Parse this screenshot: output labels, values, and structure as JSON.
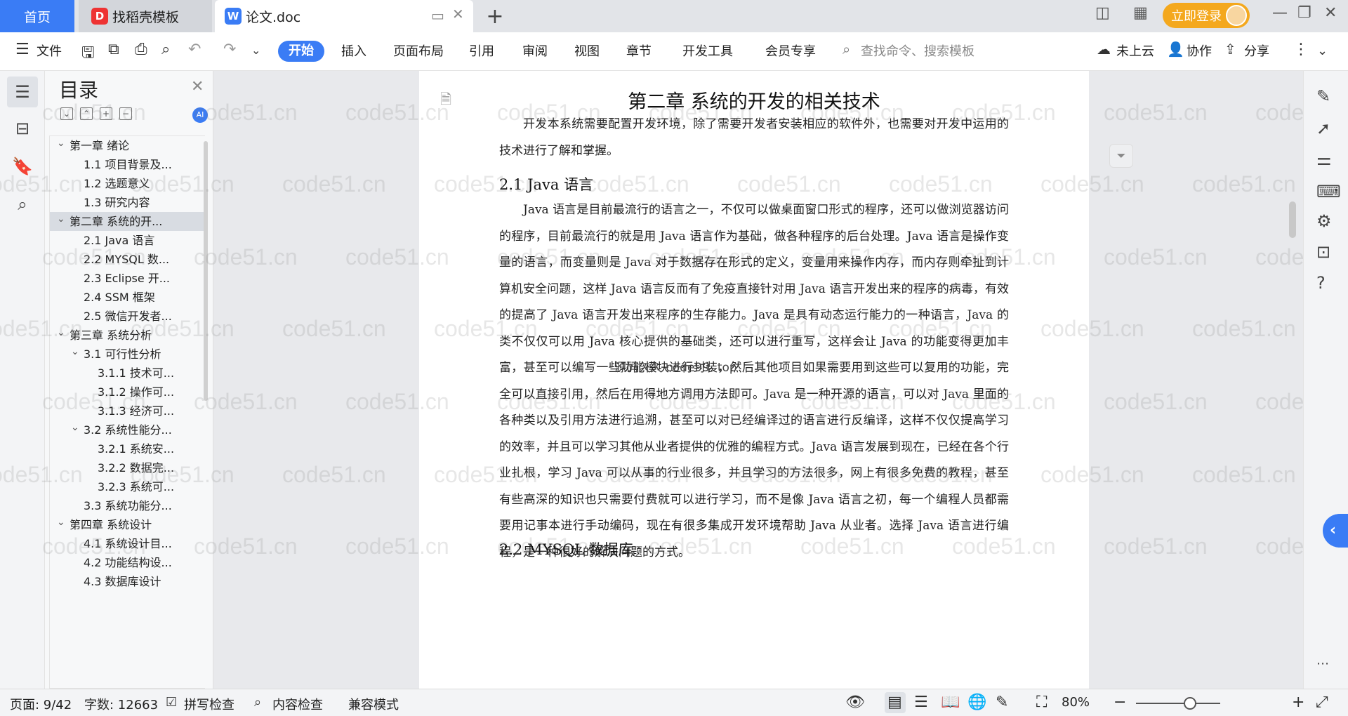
{
  "tabs": {
    "home": "首页",
    "template": "找稻壳模板",
    "document": "论文.doc",
    "new_tab": "+"
  },
  "account": {
    "login_label": "立即登录"
  },
  "ribbon": {
    "file": "文件",
    "menus": [
      "开始",
      "插入",
      "页面布局",
      "引用",
      "审阅",
      "视图",
      "章节",
      "开发工具",
      "会员专享"
    ],
    "search_placeholder": "查找命令、搜索模板",
    "cloud": "未上云",
    "collab": "协作",
    "share": "分享"
  },
  "toc": {
    "title": "目录",
    "items": [
      {
        "label": "第一章  绪论",
        "level": 1,
        "expanded": true,
        "selected": false
      },
      {
        "label": "1.1  项目背景及...",
        "level": 2,
        "selected": false
      },
      {
        "label": "1.2  选题意义",
        "level": 2,
        "selected": false
      },
      {
        "label": "1.3  研究内容",
        "level": 2,
        "selected": false
      },
      {
        "label": "第二章  系统的开...",
        "level": 1,
        "expanded": true,
        "selected": true
      },
      {
        "label": "2.1 Java 语言",
        "level": 2,
        "selected": false
      },
      {
        "label": "2.2 MYSQL 数...",
        "level": 2,
        "selected": false
      },
      {
        "label": "2.3 Eclipse 开...",
        "level": 2,
        "selected": false
      },
      {
        "label": "2.4 SSM 框架",
        "level": 2,
        "selected": false
      },
      {
        "label": "2.5 微信开发者...",
        "level": 2,
        "selected": false
      },
      {
        "label": "第三章  系统分析",
        "level": 1,
        "expanded": true,
        "selected": false
      },
      {
        "label": "3.1 可行性分析",
        "level": 2,
        "expanded": true,
        "selected": false
      },
      {
        "label": "3.1.1 技术可...",
        "level": 3,
        "selected": false
      },
      {
        "label": "3.1.2 操作可...",
        "level": 3,
        "selected": false
      },
      {
        "label": "3.1.3 经济可...",
        "level": 3,
        "selected": false
      },
      {
        "label": "3.2  系统性能分...",
        "level": 2,
        "expanded": true,
        "selected": false
      },
      {
        "label": "3.2.1  系统安...",
        "level": 3,
        "selected": false
      },
      {
        "label": "3.2.2  数据完...",
        "level": 3,
        "selected": false
      },
      {
        "label": "3.2.3  系统可...",
        "level": 3,
        "selected": false
      },
      {
        "label": "3.3 系统功能分...",
        "level": 2,
        "selected": false
      },
      {
        "label": "第四章  系统设计",
        "level": 1,
        "expanded": true,
        "selected": false
      },
      {
        "label": "4.1  系统设计目...",
        "level": 2,
        "selected": false
      },
      {
        "label": "4.2 功能结构设...",
        "level": 2,
        "selected": false
      },
      {
        "label": "4.3 数据库设计",
        "level": 2,
        "selected": false
      }
    ]
  },
  "document": {
    "title": "第二章  系统的开发的相关技术",
    "intro": "开发本系统需要配置开发环境，除了需要开发者安装相应的软件外，也需要对开发中运用的技术进行了解和掌握。",
    "section1_heading": "2.1 Java 语言",
    "section1_body": "Java 语言是目前最流行的语言之一，不仅可以做桌面窗口形式的程序，还可以做浏览器访问的程序，目前最流行的就是用 Java 语言作为基础，做各种程序的后台处理。Java 语言是操作变量的语言，而变量则是 Java 对于数据存在形式的定义，变量用来操作内存，而内存则牵扯到计算机安全问题，这样 Java 语言反而有了免疫直接针对用 Java 语言开发出来的程序的病毒，有效的提高了 Java 语言开发出来程序的生存能力。Java 是具有动态运行能力的一种语言，Java 的类不仅仅可以用 Java 核心提供的基础类，还可以进行重写，这样会让 Java 的功能变得更加丰富，甚至可以编写一些功能模块进行封装，然后其他项目如果需要用到这些可以复用的功能，完全可以直接引用，然后在用得地方调用方法即可。Java 是一种开源的语言，可以对 Java 里面的各种类以及引用方法进行追溯，甚至可以对已经编译过的语言进行反编译，这样不仅仅提高学习的效率，并且可以学习其他从业者提供的优雅的编程方式。Java 语言发展到现在，已经在各个行业扎根，学习 Java 可以从事的行业很多，并且学习的方法很多，网上有很多免费的教程，甚至有些高深的知识也只需要付费就可以进行学习，而不是像 Java 语言之初，每一个编程人员都需要用记事本进行手动编码，现在有很多集成开发环境帮助 Java 从业者。选择 Java 语言进行编程，是一种很好的解决问题的方式。",
    "section2_heading": "2.2 MYSQL 数据库",
    "overlay_text": "源码久久 code99. top",
    "watermark": "code51.cn"
  },
  "status": {
    "page": "页面: 9/42",
    "words": "字数: 12663",
    "spell": "拼写检查",
    "content_check": "内容检查",
    "compat": "兼容模式",
    "zoom": "80%"
  },
  "colors": {
    "accent": "#3a7cf5",
    "login": "#f4a81d"
  }
}
